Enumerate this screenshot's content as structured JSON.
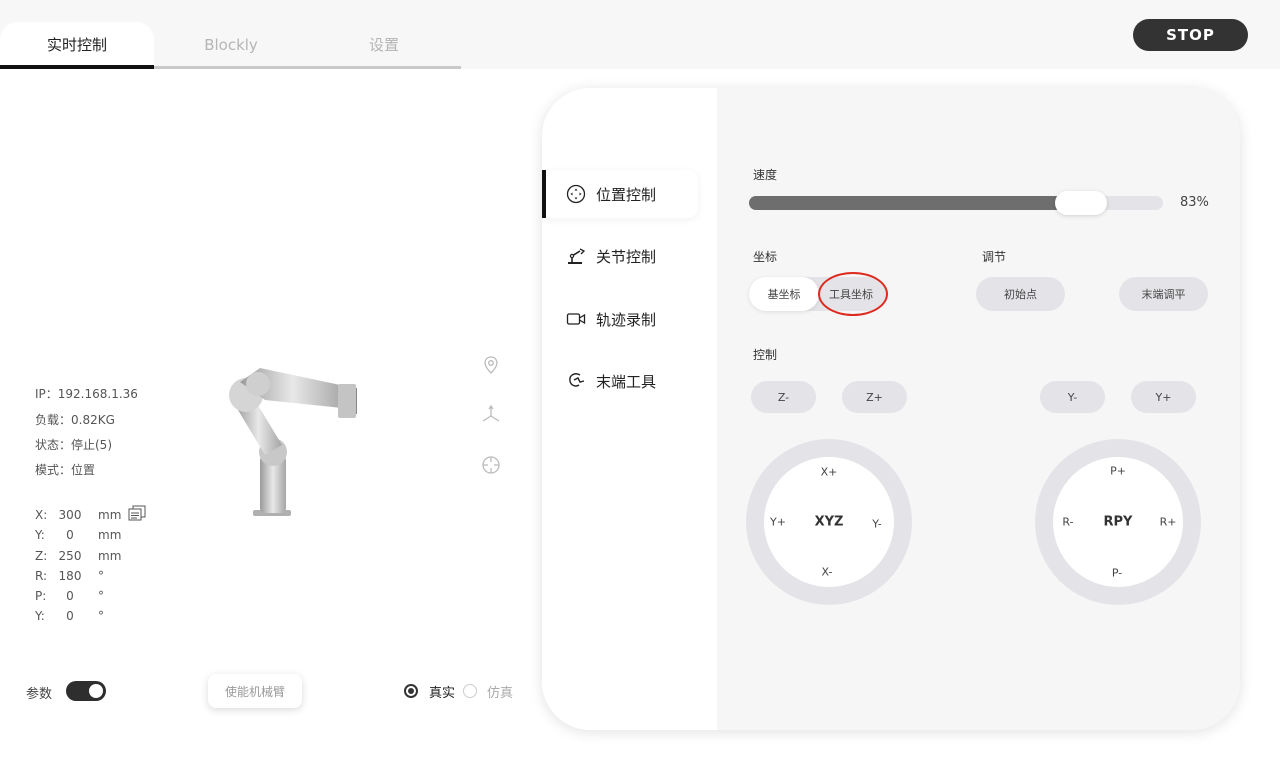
{
  "tabs": [
    {
      "label": "实时控制",
      "active": true
    },
    {
      "label": "Blockly",
      "active": false
    },
    {
      "label": "设置",
      "active": false
    }
  ],
  "stop_label": "STOP",
  "robot_info": {
    "ip": "IP：192.168.1.36",
    "load": "负载：0.82KG",
    "state": "状态：停止(5)",
    "mode": "模式：位置"
  },
  "coords": [
    {
      "key": "X:",
      "value": "300",
      "unit": "mm"
    },
    {
      "key": "Y:",
      "value": "0",
      "unit": "mm"
    },
    {
      "key": "Z:",
      "value": "250",
      "unit": "mm"
    },
    {
      "key": "R:",
      "value": "180",
      "unit": "°"
    },
    {
      "key": "P:",
      "value": "0",
      "unit": "°"
    },
    {
      "key": "Y:",
      "value": "0",
      "unit": "°"
    }
  ],
  "bottom": {
    "param_label": "参数",
    "param_on": true,
    "enable_label": "使能机械臂",
    "real_label": "真实",
    "sim_label": "仿真",
    "selected": "real"
  },
  "menu": [
    {
      "label": "位置控制",
      "icon": "position-icon",
      "active": true
    },
    {
      "label": "关节控制",
      "icon": "joint-icon",
      "active": false
    },
    {
      "label": "轨迹录制",
      "icon": "video-icon",
      "active": false
    },
    {
      "label": "末端工具",
      "icon": "gripper-icon",
      "active": false
    }
  ],
  "speed": {
    "label": "速度",
    "value_text": "83%",
    "fraction": 0.83
  },
  "coord_section": {
    "label": "坐标",
    "options": [
      "基坐标",
      "工具坐标"
    ],
    "selected": "基坐标"
  },
  "adjust_section": {
    "label": "调节",
    "home_label": "初始点",
    "level_label": "末端调平"
  },
  "control_section": {
    "label": "控制",
    "buttons": [
      "Z-",
      "Z+",
      "Y-",
      "Y+"
    ],
    "xyz": {
      "center": "XYZ",
      "top": "X+",
      "bottom": "X-",
      "left": "Y+",
      "right": "Y-"
    },
    "rpy": {
      "center": "RPY",
      "top": "P+",
      "bottom": "P-",
      "left": "R-",
      "right": "R+"
    }
  },
  "colors": {
    "accent": "#333333",
    "highlight": "#dd2a1f",
    "track": "#e4e4e8",
    "fill": "#6e6e6e"
  }
}
